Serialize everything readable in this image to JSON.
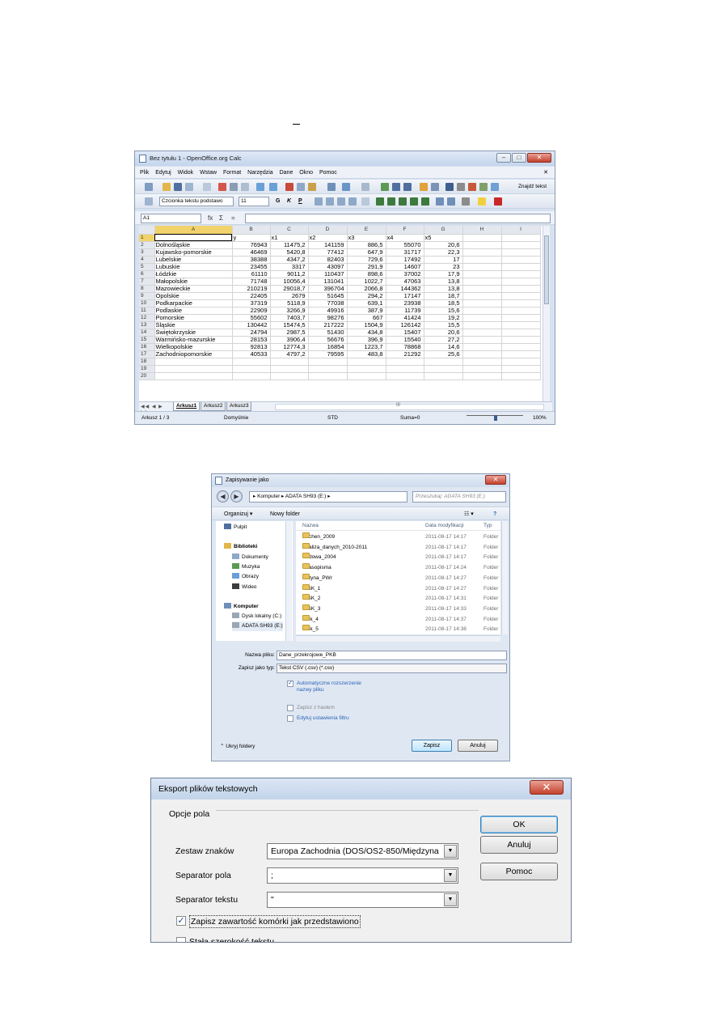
{
  "calc": {
    "title": "Bez tytułu 1 - OpenOffice.org Calc",
    "menu": [
      "Plik",
      "Edytuj",
      "Widok",
      "Wstaw",
      "Format",
      "Narzędzia",
      "Dane",
      "Okno",
      "Pomoc"
    ],
    "find_text": "Znajdź tekst",
    "font_name": "Czcionka tekstu podstawo",
    "font_size": "11",
    "bold": "G",
    "italic": "K",
    "underline": "P",
    "name_box": "A1",
    "formula_icons": {
      "fx": "fx",
      "sum": "Σ",
      "eq": "="
    },
    "columns": [
      "",
      "A",
      "B",
      "C",
      "D",
      "E",
      "F",
      "G",
      "H",
      "I"
    ],
    "rows": [
      {
        "n": "1",
        "cells": [
          "",
          "y",
          "x1",
          "x2",
          "x3",
          "x4",
          "x5",
          "",
          ""
        ]
      },
      {
        "n": "2",
        "cells": [
          "Dolnośląskie",
          "76943",
          "11475,2",
          "141159",
          "886,5",
          "55070",
          "20,6",
          "",
          ""
        ]
      },
      {
        "n": "3",
        "cells": [
          "Kujawsko-pomorskie",
          "46469",
          "5420,8",
          "77412",
          "647,9",
          "31717",
          "22,3",
          "",
          ""
        ]
      },
      {
        "n": "4",
        "cells": [
          "Lubelskie",
          "38388",
          "4347,2",
          "82403",
          "729,6",
          "17492",
          "17",
          "",
          ""
        ]
      },
      {
        "n": "5",
        "cells": [
          "Lubuskie",
          "23455",
          "3317",
          "43097",
          "291,9",
          "14607",
          "23",
          "",
          ""
        ]
      },
      {
        "n": "6",
        "cells": [
          "Łódzkie",
          "61110",
          "9011,2",
          "110437",
          "898,6",
          "37002",
          "17,9",
          "",
          ""
        ]
      },
      {
        "n": "7",
        "cells": [
          "Małopolskie",
          "71748",
          "10056,4",
          "131041",
          "1022,7",
          "47063",
          "13,8",
          "",
          ""
        ]
      },
      {
        "n": "8",
        "cells": [
          "Mazowieckie",
          "210219",
          "29018,7",
          "396704",
          "2066,8",
          "144362",
          "13,8",
          "",
          ""
        ]
      },
      {
        "n": "9",
        "cells": [
          "Opolskie",
          "22405",
          "2679",
          "51645",
          "294,2",
          "17147",
          "18,7",
          "",
          ""
        ]
      },
      {
        "n": "10",
        "cells": [
          "Podkarpackie",
          "37319",
          "5118,9",
          "77038",
          "639,1",
          "23938",
          "18,5",
          "",
          ""
        ]
      },
      {
        "n": "11",
        "cells": [
          "Podlaskie",
          "22909",
          "3266,9",
          "49916",
          "387,9",
          "11739",
          "15,6",
          "",
          ""
        ]
      },
      {
        "n": "12",
        "cells": [
          "Pomorskie",
          "55602",
          "7403,7",
          "98276",
          "667",
          "41424",
          "19,2",
          "",
          ""
        ]
      },
      {
        "n": "13",
        "cells": [
          "Śląskie",
          "130442",
          "15474,5",
          "217222",
          "1504,9",
          "126142",
          "15,5",
          "",
          ""
        ]
      },
      {
        "n": "14",
        "cells": [
          "Świętokrzyskie",
          "24794",
          "2987,5",
          "51430",
          "434,8",
          "15407",
          "20,6",
          "",
          ""
        ]
      },
      {
        "n": "15",
        "cells": [
          "Warmińsko-mazurskie",
          "28153",
          "3906,4",
          "56676",
          "396,9",
          "15540",
          "27,2",
          "",
          ""
        ]
      },
      {
        "n": "16",
        "cells": [
          "Wielkopolskie",
          "92813",
          "12774,3",
          "16854",
          "1223,7",
          "78868",
          "14,6",
          "",
          ""
        ]
      },
      {
        "n": "17",
        "cells": [
          "Zachodniopomorskie",
          "40533",
          "4797,2",
          "79595",
          "483,8",
          "21292",
          "25,6",
          "",
          ""
        ]
      },
      {
        "n": "18",
        "cells": [
          "",
          "",
          "",
          "",
          "",
          "",
          "",
          "",
          ""
        ]
      },
      {
        "n": "19",
        "cells": [
          "",
          "",
          "",
          "",
          "",
          "",
          "",
          "",
          ""
        ]
      },
      {
        "n": "20",
        "cells": [
          "",
          "",
          "",
          "",
          "",
          "",
          "",
          "",
          ""
        ]
      }
    ],
    "sheet_tabs": [
      "Arkusz1",
      "Arkusz2",
      "Arkusz3"
    ],
    "hscroll_mark": "III",
    "status": {
      "sheet": "Arkusz 1 / 3",
      "style": "Domyślnie",
      "mode": "STD",
      "sum": "Suma=0",
      "zoom": "100%"
    }
  },
  "save": {
    "title": "Zapisywanie jako",
    "breadcrumb": "▸ Komputer ▸ ADATA SH93 (E:) ▸",
    "search_placeholder": "Przeszukaj: ADATA SH93 (E:)",
    "organize": "Organizuj ▾",
    "new_folder": "Nowy folder",
    "nav": [
      {
        "label": "Pulpit",
        "type": "desktop"
      },
      {
        "label": "Biblioteki",
        "type": "library"
      },
      {
        "label": "Dokumenty",
        "type": "docs"
      },
      {
        "label": "Muzyka",
        "type": "music"
      },
      {
        "label": "Obrazy",
        "type": "pics"
      },
      {
        "label": "Wideo",
        "type": "video"
      },
      {
        "label": "Komputer",
        "type": "computer"
      },
      {
        "label": "Dysk lokalny (C:)",
        "type": "disk"
      },
      {
        "label": "ADATA SH93 (E:)",
        "type": "disk"
      }
    ],
    "columns": {
      "name": "Nazwa",
      "date": "Data modyfikacji",
      "type": "Typ"
    },
    "files": [
      {
        "name": "Aachen_2009",
        "date": "2011-08-17 14:17",
        "type": "Folder"
      },
      {
        "name": "Analiza_danych_2010-2011",
        "date": "2011-08-17 14:17",
        "type": "Folder"
      },
      {
        "name": "Budowa_2004",
        "date": "2011-08-17 14:17",
        "type": "Folder"
      },
      {
        "name": "Czasopisma",
        "date": "2011-08-17 14:24",
        "type": "Folder"
      },
      {
        "name": "Detyna_PWr",
        "date": "2011-08-17 14:27",
        "type": "Folder"
      },
      {
        "name": "DISK_1",
        "date": "2011-08-17 14:27",
        "type": "Folder"
      },
      {
        "name": "DISK_2",
        "date": "2011-08-17 14:31",
        "type": "Folder"
      },
      {
        "name": "DISK_3",
        "date": "2011-08-17 14:33",
        "type": "Folder"
      },
      {
        "name": "Disk_4",
        "date": "2011-08-17 14:37",
        "type": "Folder"
      },
      {
        "name": "Disk_5",
        "date": "2011-08-17 14:38",
        "type": "Folder"
      }
    ],
    "filename_label": "Nazwa pliku:",
    "filename": "Dane_przekrojowe_PKB",
    "filetype_label": "Zapisz jako typ:",
    "filetype": "Tekst CSV (.csv) (*.csv)",
    "opt_auto_ext": "Automatyczne rozszerzenie nazwy pliku",
    "opt_password": "Zapisz z hasłem",
    "opt_filter": "Edytuj ustawienia filtru",
    "hide_folders": "Ukryj foldery",
    "save_btn": "Zapisz",
    "cancel_btn": "Anuluj"
  },
  "export": {
    "title": "Eksport plików tekstowych",
    "group": "Opcje pola",
    "charset_label": "Zestaw znaków",
    "charset": "Europa Zachodnia (DOS/OS2-850/Międzyna",
    "field_sep_label": "Separator pola",
    "field_sep": ";",
    "text_sep_label": "Separator tekstu",
    "text_sep": "\"",
    "opt_as_shown": "Zapisz zawartość komórki jak przedstawiono",
    "opt_fixed_width": "Stała szerokość tekstu",
    "ok": "OK",
    "cancel": "Anuluj",
    "help": "Pomoc"
  }
}
